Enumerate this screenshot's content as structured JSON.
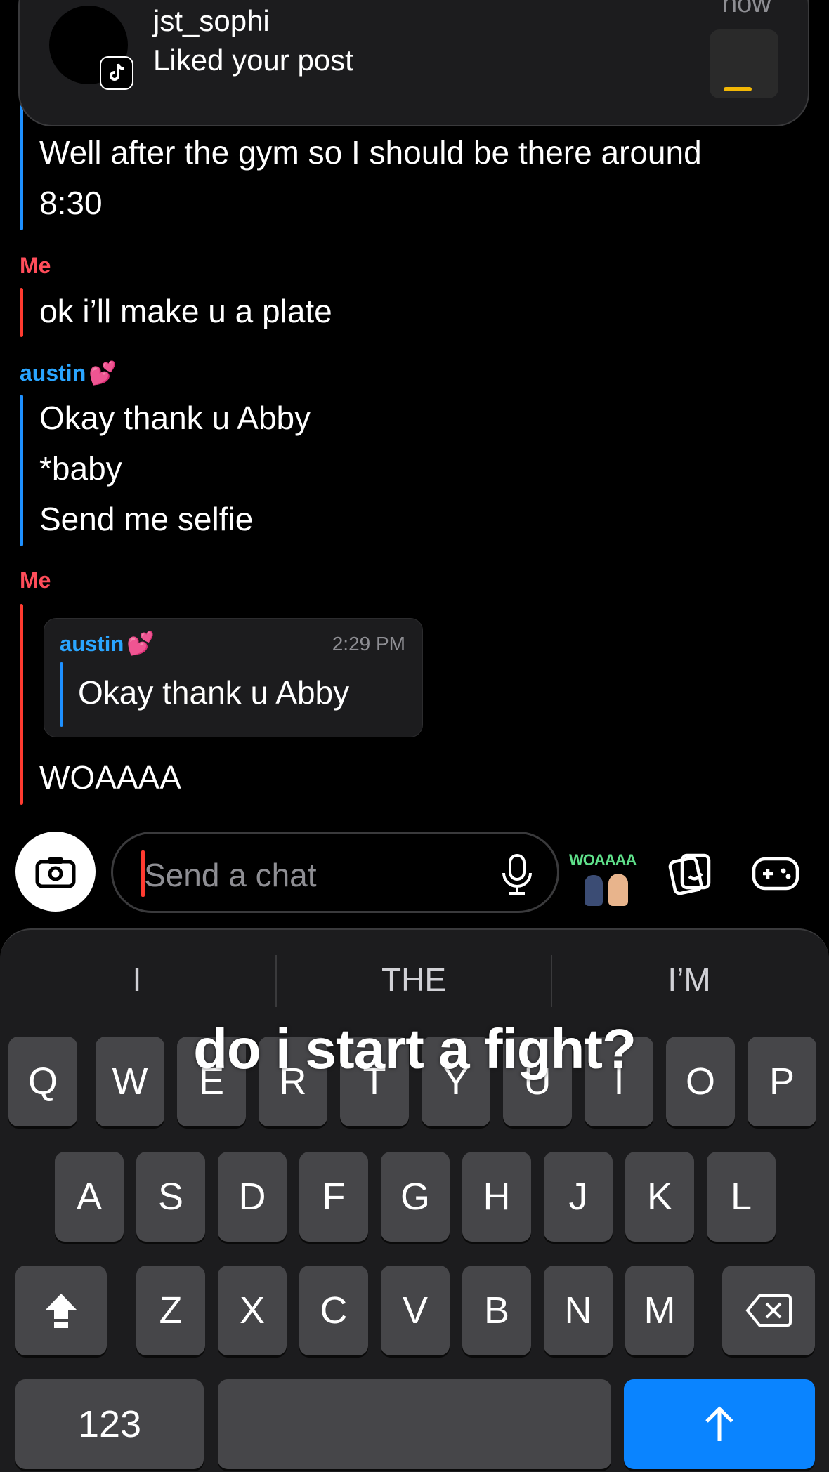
{
  "notification": {
    "username": "jst_sophi",
    "message": "Liked your post",
    "time": "now"
  },
  "messages": {
    "msg1_line1": "Well after the gym so I should be there around",
    "msg1_line2": "8:30",
    "me_label_1": "Me",
    "msg2": "ok i’ll make u a plate",
    "austin_label": "austin",
    "msg3_line1": "Okay thank u Abby",
    "msg3_line2": "*baby",
    "msg3_line3": "Send me selfie",
    "me_label_2": "Me",
    "quote": {
      "sender": "austin",
      "time": "2:29 PM",
      "text": "Okay thank u Abby"
    },
    "msg4": "WOAAAA"
  },
  "composer": {
    "placeholder": "Send a chat",
    "bitmoji_caption": "WOAAAA"
  },
  "keyboard": {
    "suggestions": [
      "I",
      "THE",
      "I’M"
    ],
    "row1": [
      "Q",
      "W",
      "E",
      "R",
      "T",
      "Y",
      "U",
      "I",
      "O",
      "P"
    ],
    "row2": [
      "A",
      "S",
      "D",
      "F",
      "G",
      "H",
      "J",
      "K",
      "L"
    ],
    "row3": [
      "Z",
      "X",
      "C",
      "V",
      "B",
      "N",
      "M"
    ],
    "numbers_label": "123"
  },
  "overlay_caption": "do i start a fight?",
  "colors": {
    "me": "#ff4d5a",
    "austin": "#2aa5ff",
    "send_key": "#0a84ff"
  }
}
